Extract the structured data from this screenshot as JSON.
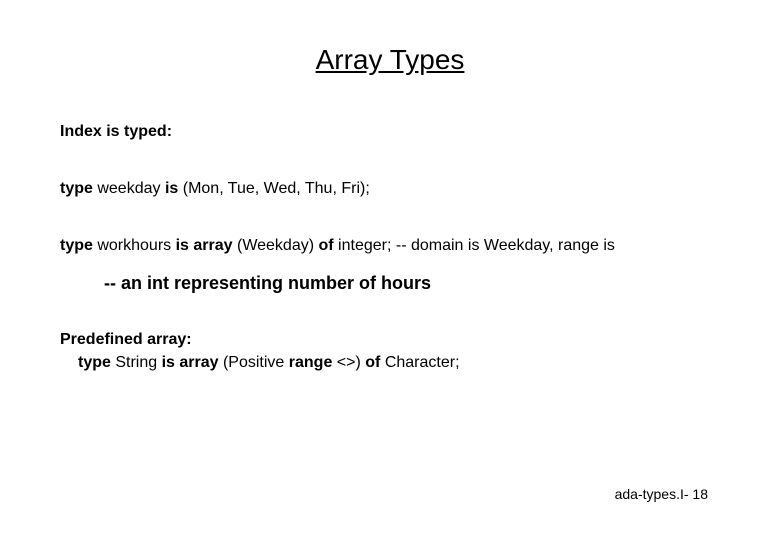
{
  "title": "Array Types",
  "lines": {
    "index_typed": "Index is typed:",
    "weekday": {
      "kw_type": "type",
      "name": " weekday ",
      "kw_is": "is",
      "rest": " (Mon, Tue, Wed, Thu, Fri);"
    },
    "workhours": {
      "kw_type": "type",
      "name": " workhours ",
      "kw_is_array": "is array",
      "paren": " (Weekday) ",
      "kw_of": "of",
      "rest": " integer; -- domain is Weekday, range is"
    },
    "comment": "-- an int representing number of hours",
    "predef_label": "Predefined array:",
    "string_decl": {
      "kw_type": "type",
      "name": " String ",
      "kw_is_array": "is array",
      "paren": " (Positive ",
      "kw_range": "range",
      "rest": " <>) ",
      "kw_of": "of",
      "tail": " Character;"
    }
  },
  "footer": "ada-types.I- 18"
}
